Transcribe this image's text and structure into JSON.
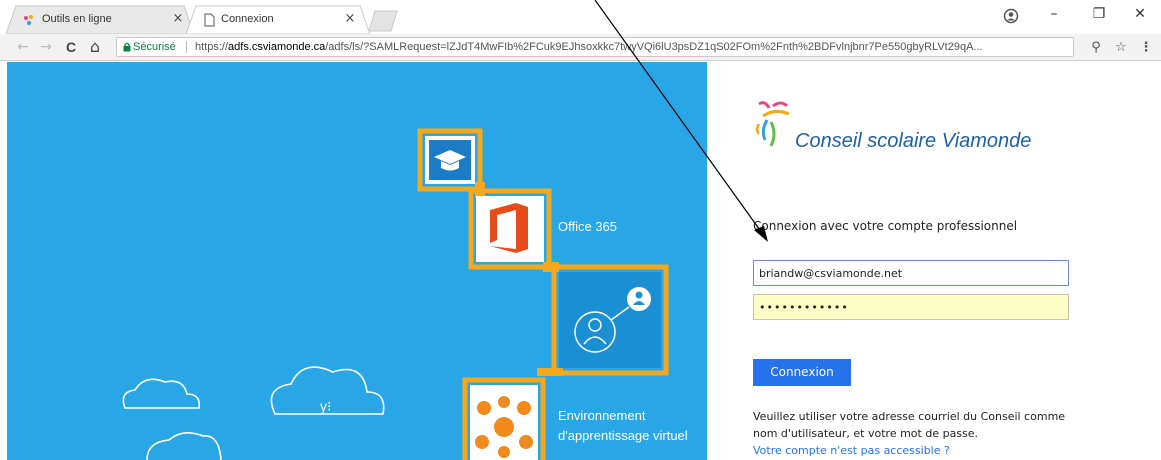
{
  "browser": {
    "tabs": [
      {
        "label": "Outils en ligne",
        "close": "×"
      },
      {
        "label": "Connexion",
        "close": "×"
      }
    ],
    "window_controls": {
      "minimize": "–",
      "restore": "❐",
      "close": "✕"
    },
    "nav": {
      "back": "←",
      "forward": "→",
      "reload": "C",
      "home": "⌂"
    },
    "address": {
      "secure_label": "Sécurisé",
      "scheme": "https://",
      "host": "adfs.csviamonde.ca",
      "path": "/adfs/ls/?SAMLRequest=lZJdT4MwFIb%2FCuk9EJhsoxkkc7twyVQi6lU3psDZ1qS02FOm%2Fnth%2BDFvlnjbnr7Pe550gbyRLVt29qA..."
    },
    "toolbar_icons": [
      "extension-icon",
      "star-icon",
      "menu-icon"
    ]
  },
  "hero": {
    "tiles": [
      {
        "label": "Office 365"
      },
      {
        "label": "Environnement"
      },
      {
        "label": "d'apprentissage virtuel"
      }
    ],
    "cloud_text": "y⁝"
  },
  "login": {
    "brand_name": "Conseil scolaire Viamonde",
    "heading": "Connexion avec votre compte professionnel",
    "email_value": "briandw@csviamonde.net",
    "password_value": "••••••••••••",
    "submit_label": "Connexion",
    "help_text": "Veuillez utiliser votre adresse courriel du Conseil comme nom d'utilisateur, et votre mot de passe.",
    "help_link": "Votre compte n'est pas accessible ?"
  },
  "colors": {
    "hero_bg": "#29a6e6",
    "tile_border": "#f4a81d",
    "button": "#2672ec",
    "brand": "#1f5fa8"
  }
}
